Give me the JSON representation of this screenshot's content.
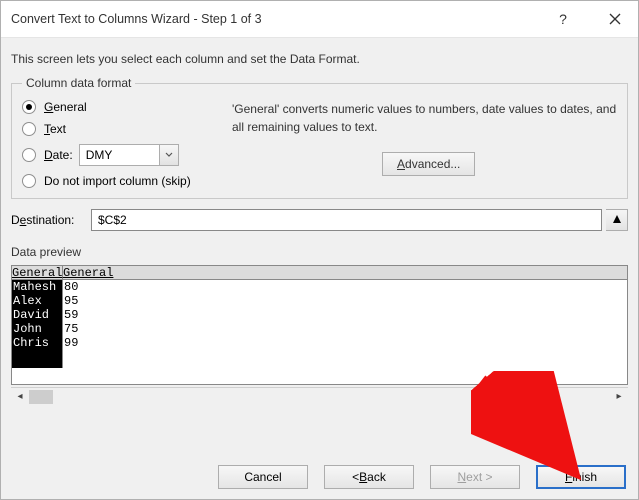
{
  "titlebar": {
    "title": "Convert Text to Columns Wizard - Step 1 of 3"
  },
  "intro": "This screen lets you select each column and set the Data Format.",
  "format": {
    "legend": "Column data format",
    "general": "General",
    "text": "Text",
    "date": "Date:",
    "date_value": "DMY",
    "skip": "Do not import column (skip)",
    "description": "'General' converts numeric values to numbers, date values to dates, and all remaining values to text.",
    "advanced": "Advanced..."
  },
  "destination": {
    "label": "Destination:",
    "value": "$C$2"
  },
  "preview": {
    "label": "Data preview",
    "header1": "General",
    "header2": "General",
    "rows": [
      {
        "c1": "Mahesh",
        "c2": "80"
      },
      {
        "c1": "Alex",
        "c2": "95"
      },
      {
        "c1": "David",
        "c2": "59"
      },
      {
        "c1": "John",
        "c2": "75"
      },
      {
        "c1": "Chris",
        "c2": "99"
      }
    ]
  },
  "buttons": {
    "cancel": "Cancel",
    "back": "< Back",
    "next": "Next >",
    "finish": "Finish"
  }
}
